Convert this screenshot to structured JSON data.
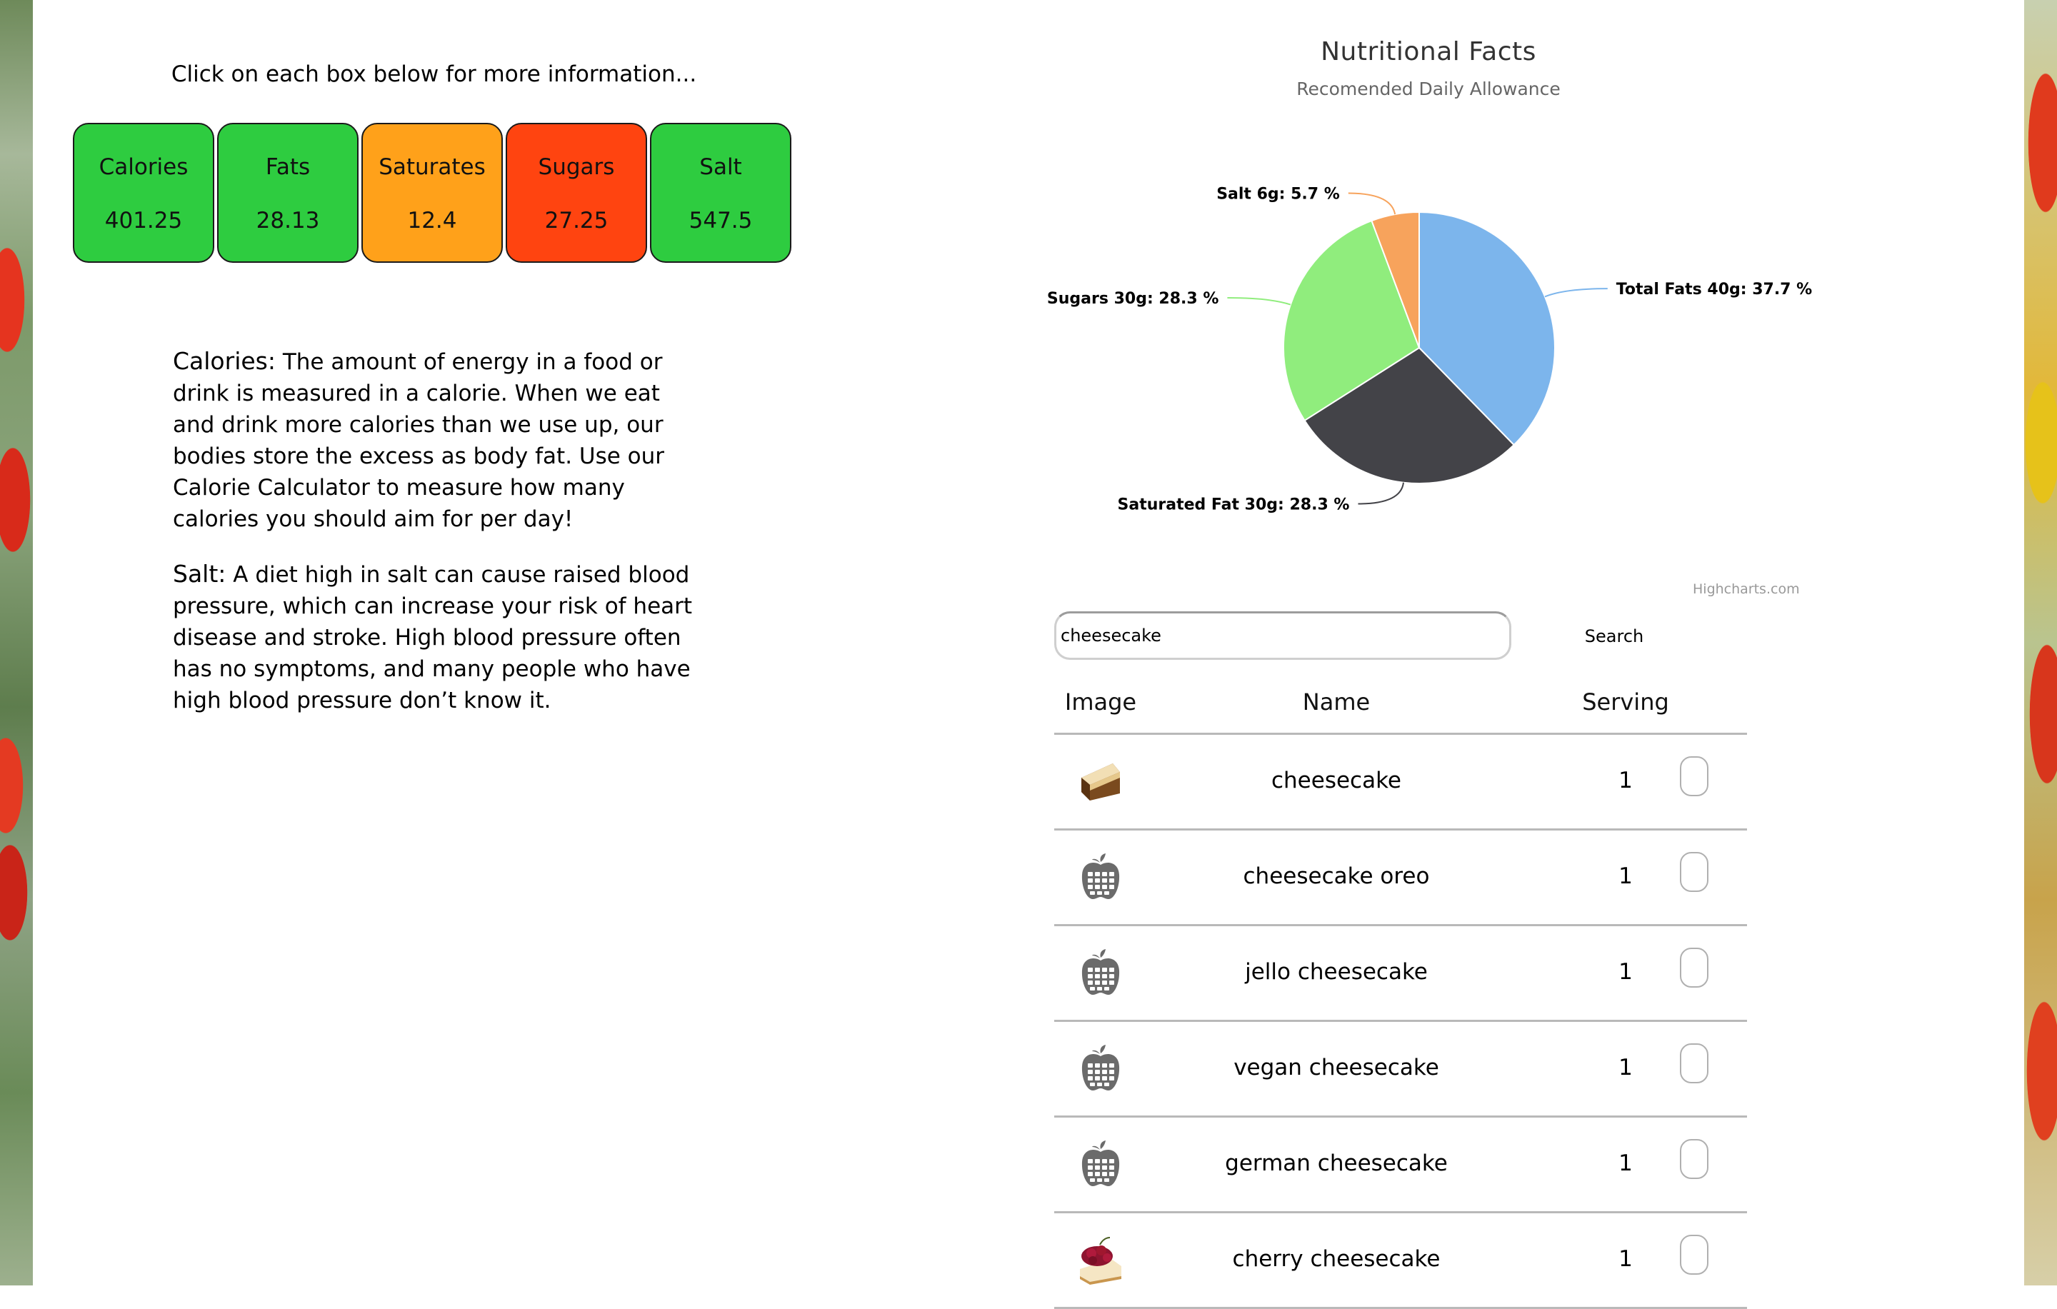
{
  "intro_text": "Click on each box below for more information...",
  "nutrient_boxes": [
    {
      "label": "Calories",
      "value": "401.25",
      "color": "#2ecc40"
    },
    {
      "label": "Fats",
      "value": "28.13",
      "color": "#2ecc40"
    },
    {
      "label": "Saturates",
      "value": "12.4",
      "color": "#ffa11a"
    },
    {
      "label": "Sugars",
      "value": "27.25",
      "color": "#ff4410"
    },
    {
      "label": "Salt",
      "value": "547.5",
      "color": "#2ecc40"
    }
  ],
  "descriptions": [
    {
      "term": "Calories:",
      "text": " The amount of energy in a food or drink is measured in a calorie. When we eat and drink more calories than we use up, our bodies store the excess as body fat. Use our Calorie Calculator to measure how many calories you should aim for per day!"
    },
    {
      "term": "Salt:",
      "text": " A diet high in salt can cause raised blood pressure, which can increase your risk of heart disease and stroke. High blood pressure often has no symptoms, and many people who have high blood pressure don’t know it."
    }
  ],
  "chart_data": {
    "type": "pie",
    "title": "Nutritional Facts",
    "subtitle": "Recomended Daily Allowance",
    "credits": "Highcharts.com",
    "slices": [
      {
        "name": "Total Fats 40g",
        "value": 37.7,
        "color": "#7cb5ec",
        "label": "Total Fats 40g: 37.7 %"
      },
      {
        "name": "Saturated Fat 30g",
        "value": 28.3,
        "color": "#434348",
        "label": "Saturated Fat 30g: 28.3 %"
      },
      {
        "name": "Sugars 30g",
        "value": 28.3,
        "color": "#90ed7d",
        "label": "Sugars 30g: 28.3 %"
      },
      {
        "name": "Salt 6g",
        "value": 5.7,
        "color": "#f7a35c",
        "label": "Salt 6g: 5.7 %"
      }
    ]
  },
  "search": {
    "value": "cheesecake",
    "button_label": "Search"
  },
  "table": {
    "headers": {
      "image": "Image",
      "name": "Name",
      "serving": "Serving"
    },
    "rows": [
      {
        "name": "cheesecake",
        "serving": "1",
        "icon": "cheesecake-slice-icon"
      },
      {
        "name": "cheesecake oreo",
        "serving": "1",
        "icon": "apple-calculator-icon"
      },
      {
        "name": "jello cheesecake",
        "serving": "1",
        "icon": "apple-calculator-icon"
      },
      {
        "name": "vegan cheesecake",
        "serving": "1",
        "icon": "apple-calculator-icon"
      },
      {
        "name": "german cheesecake",
        "serving": "1",
        "icon": "apple-calculator-icon"
      },
      {
        "name": "cherry cheesecake",
        "serving": "1",
        "icon": "cherry-cheesecake-icon"
      }
    ]
  }
}
